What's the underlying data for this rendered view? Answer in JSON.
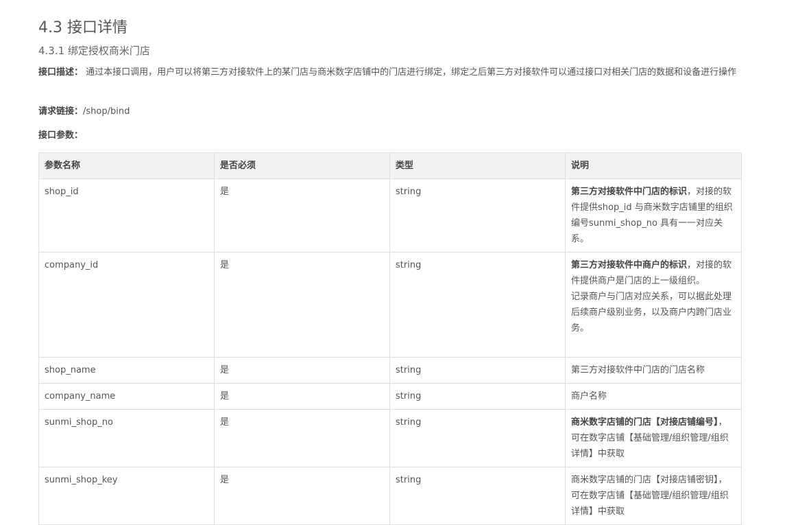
{
  "section": {
    "title": "4.3 接口详情",
    "subtitle": "4.3.1 绑定授权商米门店"
  },
  "description": {
    "label": "接口描述：",
    "text": " 通过本接口调用，用户可以将第三方对接软件上的某门店与商米数字店铺中的门店进行绑定，绑定之后第三方对接软件可以通过接口对相关门店的数据和设备进行操作"
  },
  "request": {
    "label": "请求链接：",
    "url": "/shop/bind"
  },
  "params_label": "接口参数：",
  "table": {
    "headers": [
      "参数名称",
      "是否必须",
      "类型",
      "说明"
    ],
    "rows": [
      {
        "name": "shop_id",
        "required": "是",
        "type": "string",
        "note_bold": "第三方对接软件中门店的标识",
        "note_rest": "，对接的软件提供shop_id 与商米数字店铺里的组织编号sunmi_shop_no 具有一一对应关系。"
      },
      {
        "name": "company_id",
        "required": "是",
        "type": "string",
        "note_bold": "第三方对接软件中商户的标识",
        "note_rest": "，对接的软件提供商户是门店的上一级组织。",
        "note_extra": "记录商户与门店对应关系，可以据此处理后续商户级别业务，以及商户内跨门店业务。"
      },
      {
        "name": "shop_name",
        "required": "是",
        "type": "string",
        "note": "第三方对接软件中门店的门店名称"
      },
      {
        "name": "company_name",
        "required": "是",
        "type": "string",
        "note": "商户名称"
      },
      {
        "name": "sunmi_shop_no",
        "required": "是",
        "type": "string",
        "note_bold": "商米数字店铺的门店【对接店铺编号】",
        "note_rest": "， 可在数字店铺【基础管理/组织管理/组织详情】中获取"
      },
      {
        "name": "sunmi_shop_key",
        "required": "是",
        "type": "string",
        "note": "商米数字店铺的门店【对接店铺密钥】， 可在数字店铺【基础管理/组织管理/组织详情】中获取"
      }
    ]
  }
}
